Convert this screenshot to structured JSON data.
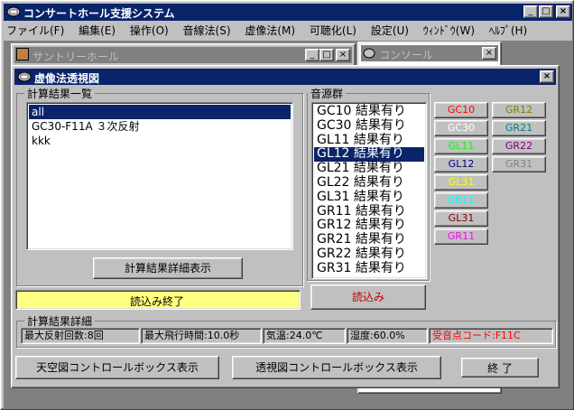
{
  "app": {
    "title": "コンサートホール支援システム"
  },
  "menu": [
    "ファイル(F)",
    "編集(E)",
    "操作(O)",
    "音線法(S)",
    "虚像法(M)",
    "可聴化(L)",
    "設定(U)",
    "ｳｨﾝﾄﾞｳ(W)",
    "ﾍﾙﾌﾟ(H)"
  ],
  "bg_windows": {
    "hall_title": "サントリーホール",
    "console_title": "コンソール"
  },
  "dialog": {
    "title": "虚像法透視図",
    "results_group_label": "計算結果一覧",
    "results_list": [
      "all",
      "GC30-F11A ３次反射",
      "kkk"
    ],
    "detail_button": "計算結果詳細表示",
    "status_text": "読込み終了",
    "sources_group_label": "音源群",
    "sources_list": [
      "GC10 結果有り",
      "GC30 結果有り",
      "GL11 結果有り",
      "GL12 結果有り",
      "GL21 結果有り",
      "GL22 結果有り",
      "GL31 結果有り",
      "GR11 結果有り",
      "GR12 結果有り",
      "GR21 結果有り",
      "GR22 結果有り",
      "GR31 結果有り"
    ],
    "load_button": "読込み",
    "source_buttons": [
      {
        "label": "GC10",
        "color": "#ff0000"
      },
      {
        "label": "GR12",
        "color": "#808000"
      },
      {
        "label": "GC30",
        "color": "#ffffff"
      },
      {
        "label": "GR21",
        "color": "#008080"
      },
      {
        "label": "GL11",
        "color": "#00ff00"
      },
      {
        "label": "GR22",
        "color": "#800080"
      },
      {
        "label": "GL12",
        "color": "#000080"
      },
      {
        "label": "GR31",
        "color": "#808080"
      },
      {
        "label": "GL31",
        "color": "#ffff00"
      },
      {
        "label": "GR11",
        "color": "#00ffff"
      },
      {
        "label": "GL31",
        "color": "#800000"
      },
      {
        "label": "GR11",
        "color": "#ff00ff"
      }
    ],
    "details_group_label": "計算結果詳細",
    "details": {
      "max_reflections": "最大反射回数:8回",
      "max_flight_time": "最大飛行時間:10.0秒",
      "temperature": "気温:24.0℃",
      "humidity": "湿度:60.0%",
      "receiver_code": "受音点コード:F11C"
    },
    "sky_button": "天空図コントロールボックス表示",
    "persp_button": "透視図コントロールボックス表示",
    "close_button": "終 了"
  }
}
